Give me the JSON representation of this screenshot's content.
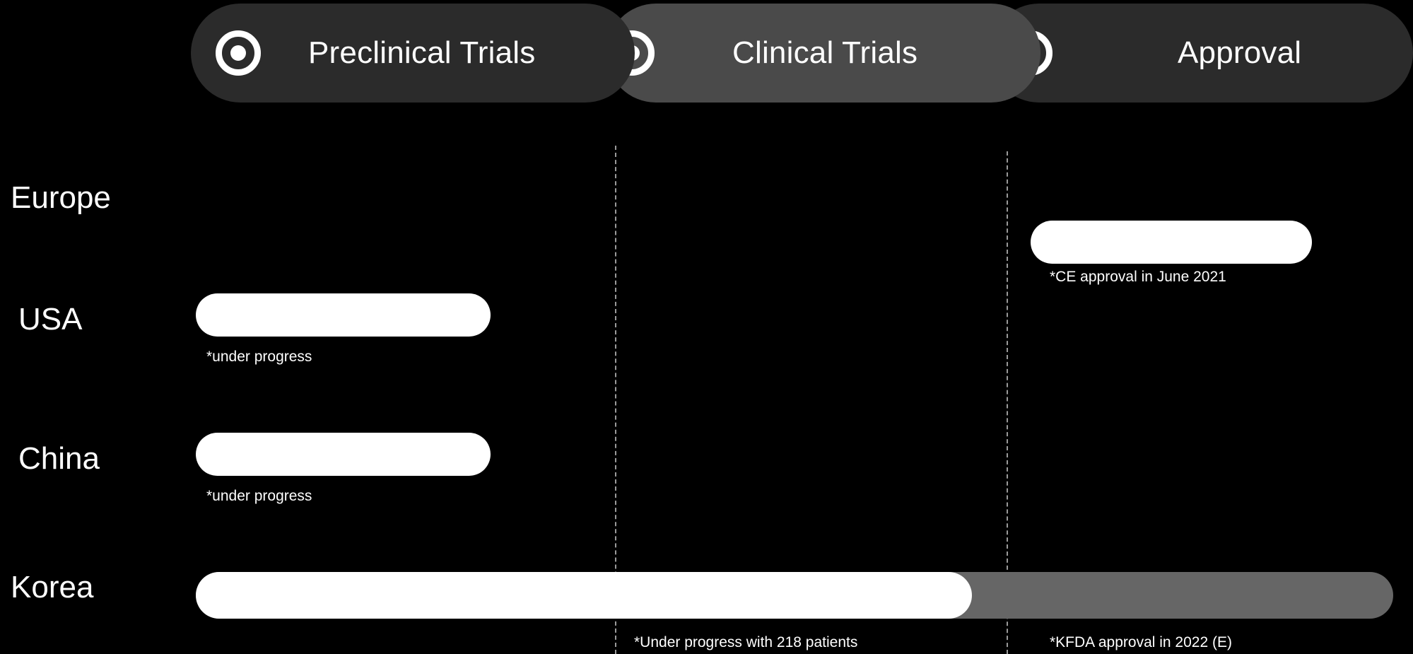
{
  "stages": [
    {
      "id": "preclinical",
      "label": "Preclinical Trials",
      "icon": "target-icon"
    },
    {
      "id": "clinical",
      "label": "Clinical Trials",
      "icon": "target-icon"
    },
    {
      "id": "approval",
      "label": "Approval",
      "icon": "target-icon"
    }
  ],
  "regions": [
    {
      "name": "Europe",
      "note": "*CE approval in June 2021",
      "status": "completed",
      "stage": "Approval"
    },
    {
      "name": "USA",
      "note": "*under progress",
      "status": "in-progress",
      "stage": "Preclinical Trials"
    },
    {
      "name": "China",
      "note": "*under progress",
      "status": "in-progress",
      "stage": "Preclinical Trials"
    },
    {
      "name": "Korea",
      "note_clinical": "*Under progress with 218 patients",
      "note_approval": "*KFDA approval in 2022 (E)",
      "status": "in-progress",
      "stage": "Clinical Trials"
    }
  ],
  "colors": {
    "background": "#000000",
    "stage_dark": "#2b2b2b",
    "stage_highlight": "#4a4a4a",
    "bar_complete": "#ffffff",
    "bar_pending": "#666666",
    "text": "#ffffff"
  }
}
